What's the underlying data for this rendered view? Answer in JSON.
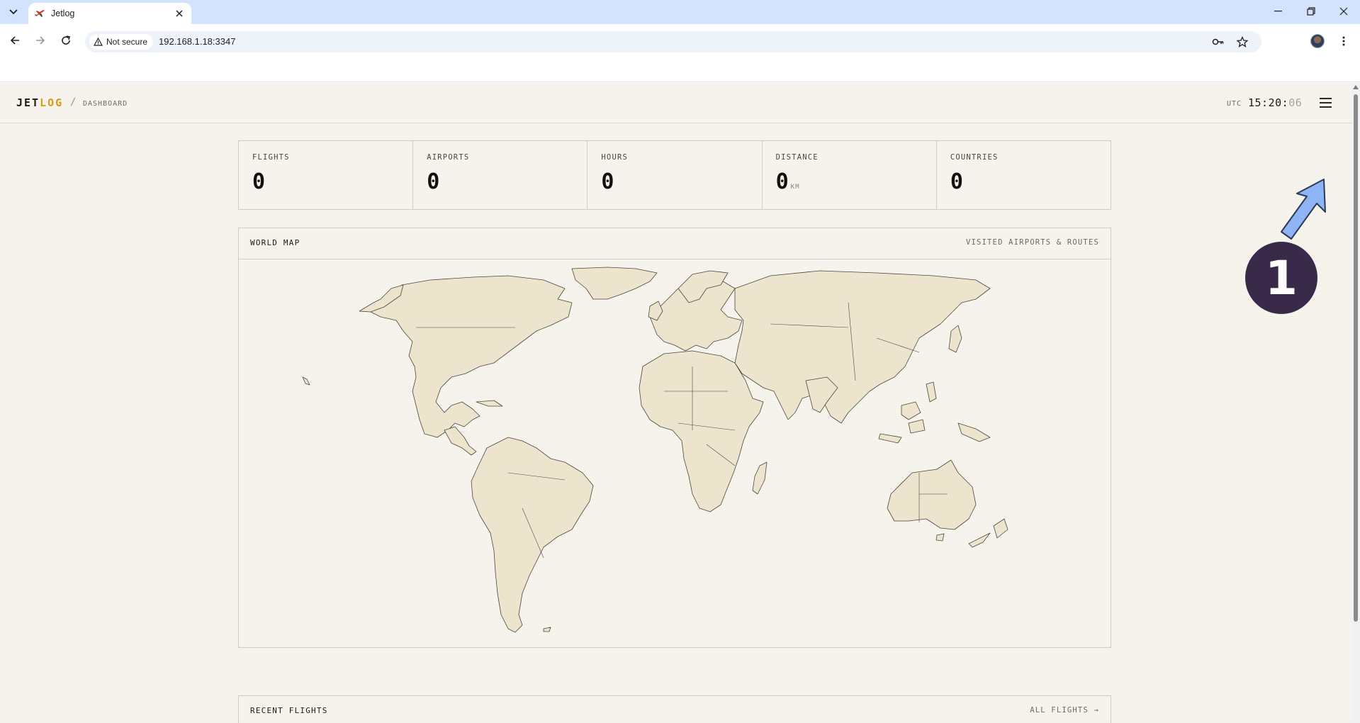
{
  "browser": {
    "tab_title": "Jetlog",
    "security_label": "Not secure",
    "url": "192.168.1.18:3347"
  },
  "app": {
    "logo_primary": "JET",
    "logo_accent": "LOG",
    "breadcrumb_sep": "/",
    "breadcrumb": "DASHBOARD",
    "clock_zone": "UTC",
    "clock_hm": "15:20:",
    "clock_sec": "06"
  },
  "stats": [
    {
      "label": "FLIGHTS",
      "value": "0",
      "unit": ""
    },
    {
      "label": "AIRPORTS",
      "value": "0",
      "unit": ""
    },
    {
      "label": "HOURS",
      "value": "0",
      "unit": ""
    },
    {
      "label": "DISTANCE",
      "value": "0",
      "unit": "KM"
    },
    {
      "label": "COUNTRIES",
      "value": "0",
      "unit": ""
    }
  ],
  "map_card": {
    "title": "WORLD MAP",
    "meta": "VISITED AIRPORTS & ROUTES"
  },
  "recent_card": {
    "title": "RECENT FLIGHTS",
    "link": "ALL FLIGHTS →"
  },
  "annotation": {
    "step_number": "1"
  },
  "colors": {
    "page_bg": "#f7f4ed",
    "land": "#ede4cd",
    "accent": "#d99a1a",
    "callout": "#3a2a4a",
    "arrow": "#8fb4f5"
  },
  "icons": [
    "tab-search-icon",
    "plane-favicon-icon",
    "close-icon",
    "minimize-icon",
    "restore-icon",
    "back-icon",
    "forward-icon",
    "reload-icon",
    "warning-icon",
    "password-key-icon",
    "star-icon",
    "kebab-icon",
    "hamburger-icon"
  ]
}
